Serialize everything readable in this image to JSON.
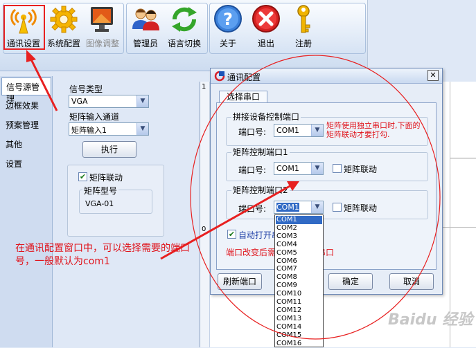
{
  "toolbar": {
    "items": [
      {
        "label": "通讯设置",
        "icon": "antenna-icon"
      },
      {
        "label": "系统配置",
        "icon": "gear-icon"
      },
      {
        "label": "图像调整",
        "icon": "monitor-icon",
        "disabled": true
      },
      {
        "label": "管理员",
        "icon": "users-icon"
      },
      {
        "label": "语言切换",
        "icon": "refresh-arrows-icon"
      },
      {
        "label": "关于",
        "icon": "help-icon"
      },
      {
        "label": "退出",
        "icon": "close-circle-icon"
      },
      {
        "label": "注册",
        "icon": "key-icon"
      }
    ]
  },
  "nav": {
    "items": [
      "信号源管理",
      "边框效果",
      "预案管理",
      "其他",
      "设置"
    ],
    "selected": "信号源管理"
  },
  "main": {
    "signal_type_label": "信号类型",
    "signal_type_value": "VGA",
    "matrix_input_label": "矩阵输入通道",
    "matrix_input_value": "矩阵输入1",
    "execute_label": "执行",
    "matrix_link_label": "矩阵联动",
    "matrix_link_checked": true,
    "matrix_model_label": "矩阵型号",
    "matrix_model_value": "VGA-01"
  },
  "right_area": {
    "marker_top": "1",
    "marker_mid": "0"
  },
  "dialog": {
    "title": "通讯配置",
    "close_glyph": "✕",
    "tab_label": "选择串口",
    "group1_title": "拼接设备控制端口",
    "group1_port_label": "端口号:",
    "group1_port_value": "COM1",
    "group1_note": "矩阵使用独立串口时,下面的矩阵联动才要打勾.",
    "group2_title": "矩阵控制端口1",
    "group2_port_label": "端口号:",
    "group2_port_value": "COM1",
    "group2_link_label": "矩阵联动",
    "group3_title": "矩阵控制端口2",
    "group3_port_label": "端口号:",
    "group3_port_value": "COM1",
    "group3_link_label": "矩阵联动",
    "auto_open_label": "自动打开串口",
    "auto_open_checked": true,
    "port_change_note": "端口改变后需要重新打开串口",
    "refresh_button": "刷新端口",
    "ok_button": "确定",
    "cancel_button": "取消"
  },
  "dropdown": {
    "options": [
      "COM1",
      "COM2",
      "COM3",
      "COM4",
      "COM5",
      "COM6",
      "COM7",
      "COM8",
      "COM9",
      "COM10",
      "COM11",
      "COM12",
      "COM13",
      "COM14",
      "COM15",
      "COM16"
    ],
    "selected": "COM1"
  },
  "annotation": {
    "text": "在通讯配置窗口中，可以选择需要的端口号，一般默认为com1"
  },
  "watermark": {
    "text": "Baidu 经验"
  },
  "colors": {
    "annotation_red": "#e0141c",
    "highlight_red": "#e82020",
    "selection_blue": "#316ac5"
  }
}
